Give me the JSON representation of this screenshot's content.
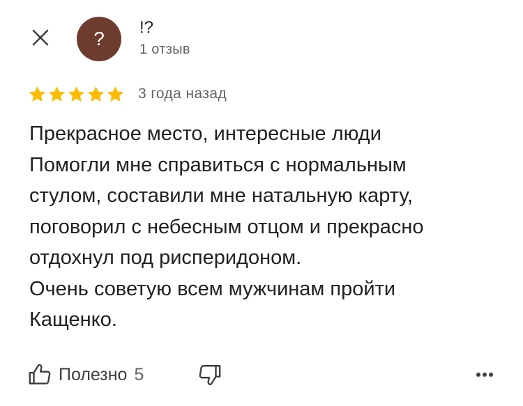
{
  "header": {
    "close_icon": "close-icon",
    "avatar_glyph": "?",
    "avatar_color": "#6d3c2e",
    "author_name": "!?",
    "author_meta": "1 отзыв"
  },
  "rating": {
    "stars": 5,
    "max_stars": 5,
    "star_color": "#fbbc04",
    "date": "3 года назад"
  },
  "review": {
    "lines": [
      "Прекрасное место, интересные люди",
      "Помогли мне справиться с нормальным",
      "стулом, составили мне натальную карту,",
      "поговорил с небесным отцом и прекрасно",
      "отдохнул под рисперидоном.",
      "Очень советую всем мужчинам пройти",
      "Кащенко."
    ]
  },
  "actions": {
    "helpful_icon": "thumbs-up-icon",
    "helpful_label": "Полезно",
    "helpful_count": "5",
    "dislike_icon": "thumbs-down-icon",
    "more_icon": "more-horizontal-icon"
  }
}
